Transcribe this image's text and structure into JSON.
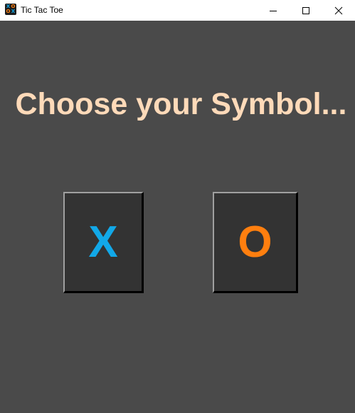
{
  "window": {
    "title": "Tic Tac Toe",
    "app_icon_glyphs": [
      "X",
      "O",
      "O",
      "X"
    ]
  },
  "colors": {
    "background": "#4a4a4a",
    "heading": "#ffdab9",
    "button_bg": "#333333",
    "x_color": "#12a8e8",
    "o_color": "#ff7f0f"
  },
  "main": {
    "heading": "Choose your Symbol...",
    "symbols": {
      "x_label": "X",
      "o_label": "O"
    }
  }
}
